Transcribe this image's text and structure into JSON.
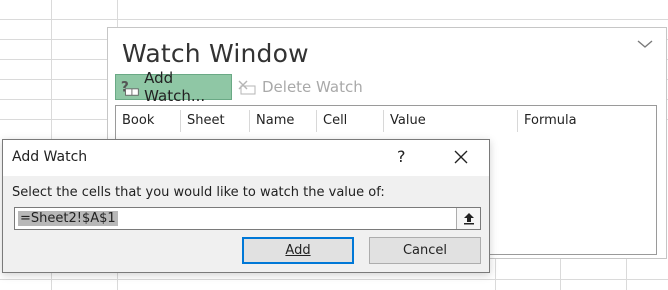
{
  "watch_window": {
    "title": "Watch Window",
    "add_watch_label": "Add Watch...",
    "delete_watch_label": "Delete Watch",
    "columns": [
      "Book",
      "Sheet",
      "Name",
      "Cell",
      "Value",
      "Formula"
    ]
  },
  "add_watch_dialog": {
    "title": "Add Watch",
    "help_label": "?",
    "prompt": "Select the cells that you would like to watch the value of:",
    "input_value": "=Sheet2!$A$1",
    "add_button": "Add",
    "cancel_button": "Cancel"
  },
  "colors": {
    "accent_green": "#8fc7a5",
    "focus_blue": "#0078d7"
  }
}
